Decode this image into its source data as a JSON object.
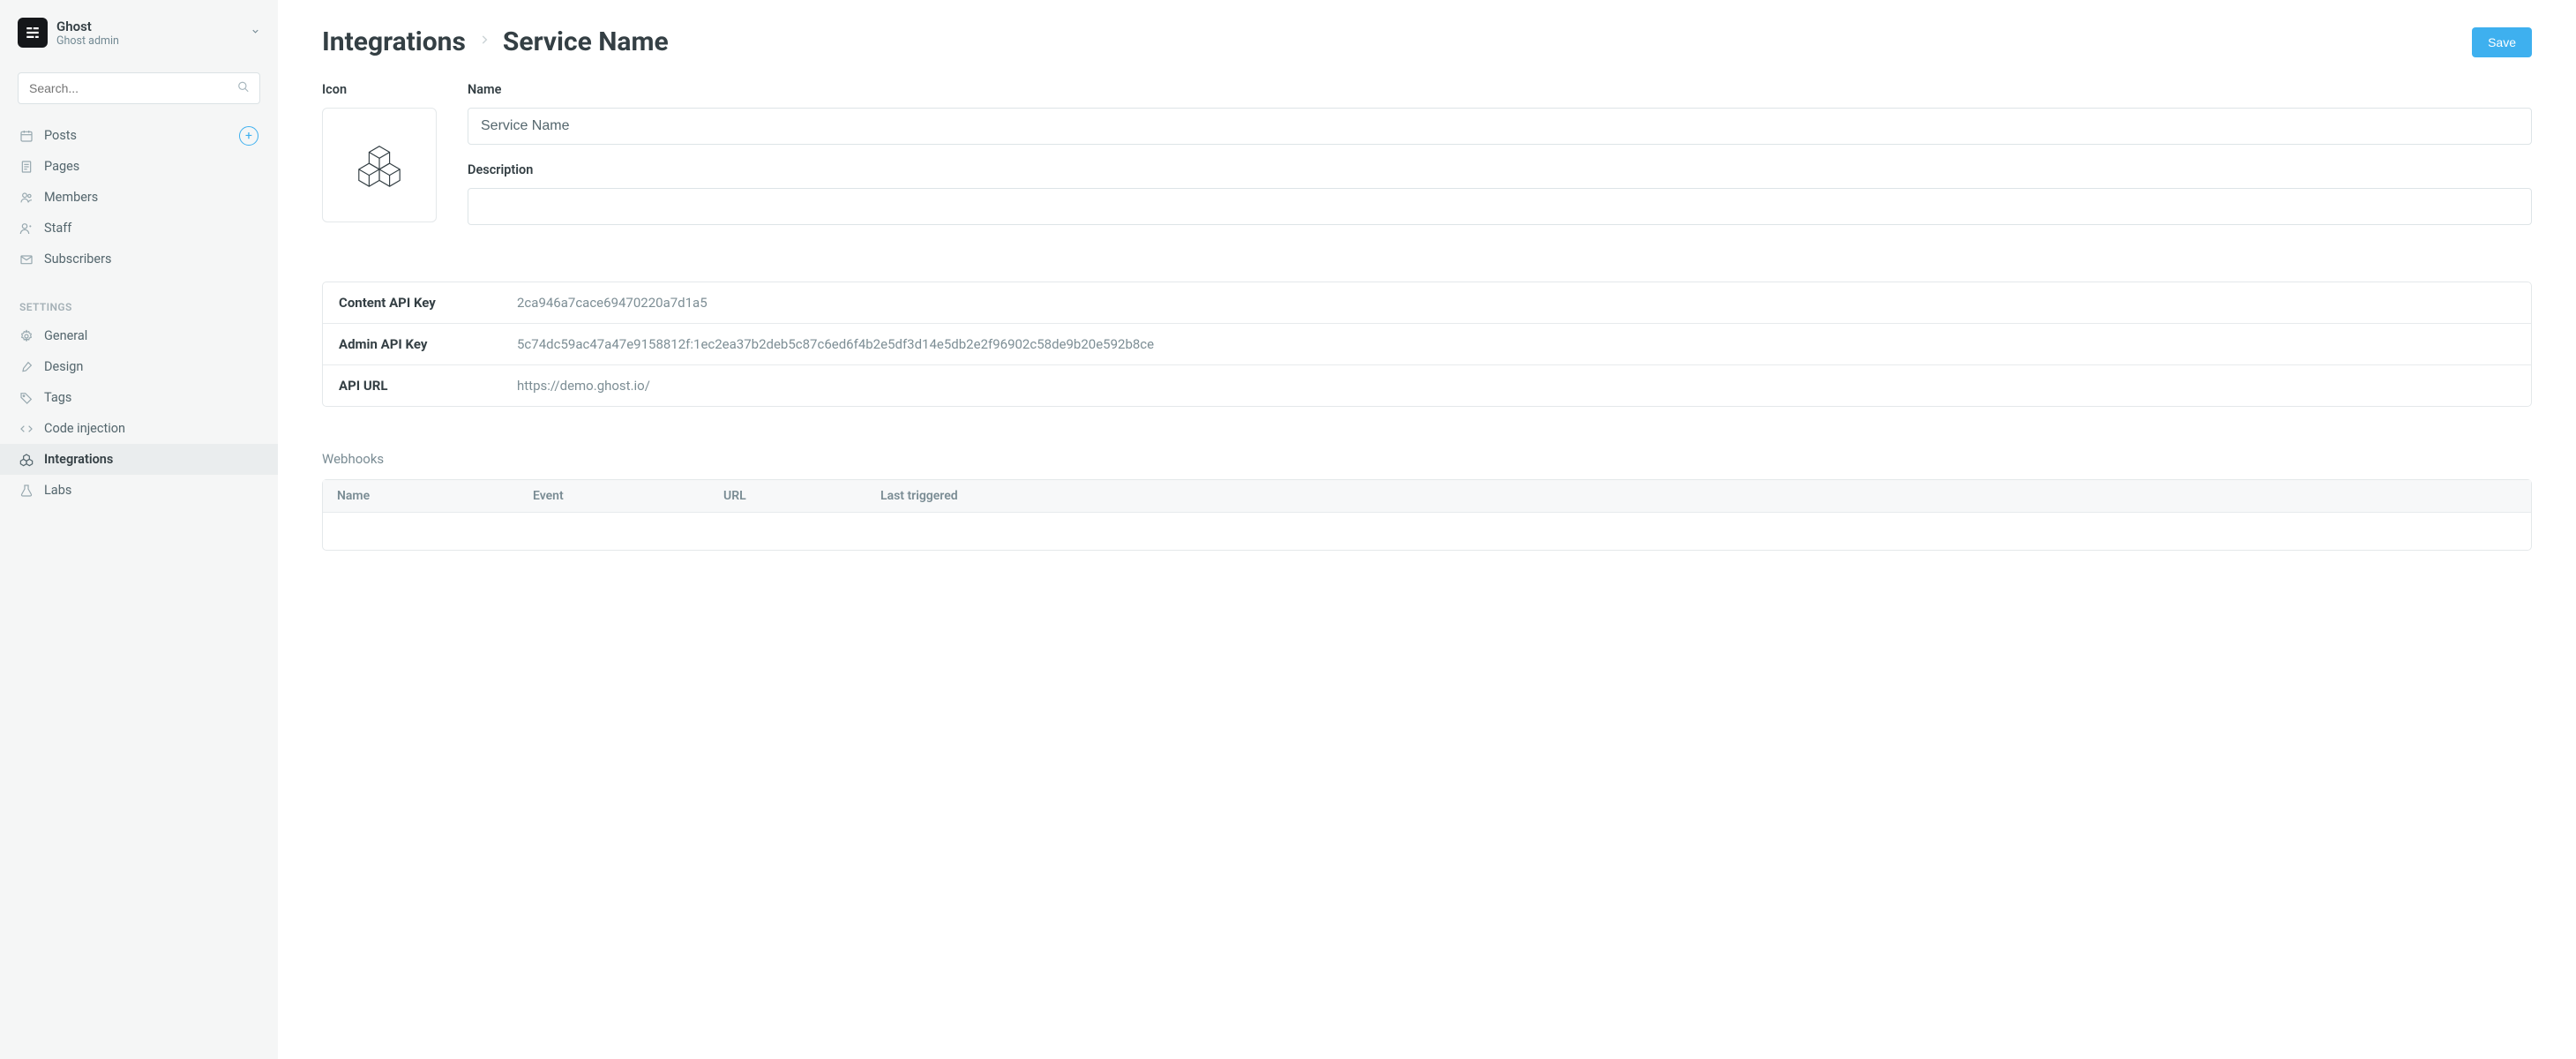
{
  "brand": {
    "name": "Ghost",
    "subtitle": "Ghost admin"
  },
  "search": {
    "placeholder": "Search..."
  },
  "nav": {
    "main": {
      "posts": "Posts",
      "pages": "Pages",
      "members": "Members",
      "staff": "Staff",
      "subscribers": "Subscribers"
    },
    "settings_title": "SETTINGS",
    "settings": {
      "general": "General",
      "design": "Design",
      "tags": "Tags",
      "code_injection": "Code injection",
      "integrations": "Integrations",
      "labs": "Labs"
    }
  },
  "header": {
    "breadcrumb_root": "Integrations",
    "breadcrumb_current": "Service Name",
    "save_label": "Save"
  },
  "form": {
    "icon_label": "Icon",
    "name_label": "Name",
    "name_value": "Service Name",
    "description_label": "Description",
    "description_value": ""
  },
  "api": {
    "content_key_label": "Content API Key",
    "content_key_value": "2ca946a7cace69470220a7d1a5",
    "admin_key_label": "Admin API Key",
    "admin_key_value": "5c74dc59ac47a47e9158812f:1ec2ea37b2deb5c87c6ed6f4b2e5df3d14e5db2e2f96902c58de9b20e592b8ce",
    "url_label": "API URL",
    "url_value": "https://demo.ghost.io/"
  },
  "webhooks": {
    "title": "Webhooks",
    "columns": {
      "name": "Name",
      "event": "Event",
      "url": "URL",
      "last_triggered": "Last triggered"
    }
  }
}
